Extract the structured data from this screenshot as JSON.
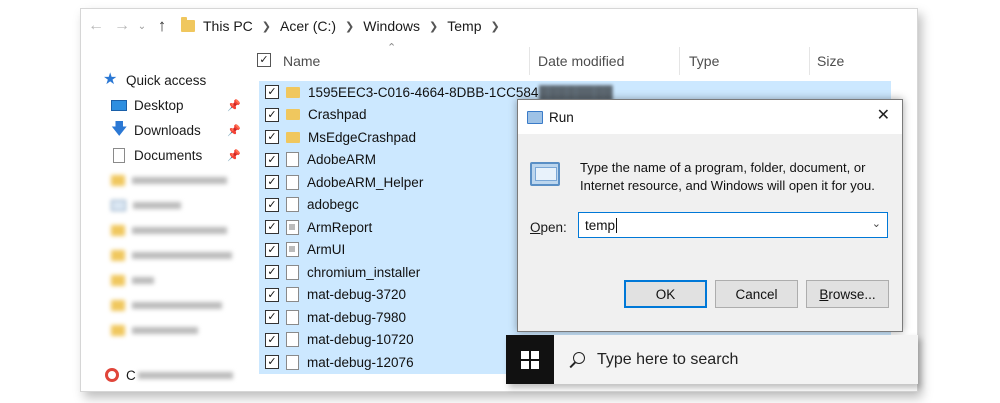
{
  "address_bar": {
    "path": [
      "This PC",
      "Acer (C:)",
      "Windows",
      "Temp"
    ]
  },
  "sidebar": {
    "quick_access_label": "Quick access",
    "items": [
      {
        "label": "Desktop",
        "icon": "desktop-icon",
        "pinned": true
      },
      {
        "label": "Downloads",
        "icon": "download-arrow-icon",
        "pinned": true
      },
      {
        "label": "Documents",
        "icon": "documents-icon",
        "pinned": true
      }
    ],
    "creative_cloud_prefix": "C"
  },
  "columns": {
    "name": "Name",
    "date_modified": "Date modified",
    "type": "Type",
    "size": "Size"
  },
  "files": [
    {
      "name": "1595EEC3-C016-4664-8DBB-1CC584",
      "icon": "folder"
    },
    {
      "name": "Crashpad",
      "icon": "folder"
    },
    {
      "name": "MsEdgeCrashpad",
      "icon": "folder"
    },
    {
      "name": "AdobeARM",
      "icon": "file"
    },
    {
      "name": "AdobeARM_Helper",
      "icon": "file"
    },
    {
      "name": "adobegc",
      "icon": "file"
    },
    {
      "name": "ArmReport",
      "icon": "app"
    },
    {
      "name": "ArmUI",
      "icon": "app"
    },
    {
      "name": "chromium_installer",
      "icon": "file"
    },
    {
      "name": "mat-debug-3720",
      "icon": "file"
    },
    {
      "name": "mat-debug-7980",
      "icon": "file"
    },
    {
      "name": "mat-debug-10720",
      "icon": "file"
    },
    {
      "name": "mat-debug-12076",
      "icon": "file"
    }
  ],
  "run_dialog": {
    "title": "Run",
    "description": "Type the name of a program, folder, document, or Internet resource, and Windows will open it for you.",
    "open_label_underlined": "O",
    "open_label_rest": "pen:",
    "input_value": "temp",
    "ok_label": "OK",
    "cancel_label": "Cancel",
    "browse_label_underlined": "B",
    "browse_label_rest": "rowse..."
  },
  "taskbar": {
    "search_placeholder": "Type here to search"
  },
  "colors": {
    "selection": "#cce8ff",
    "accent": "#0078d7",
    "folder": "#f0c75e"
  }
}
